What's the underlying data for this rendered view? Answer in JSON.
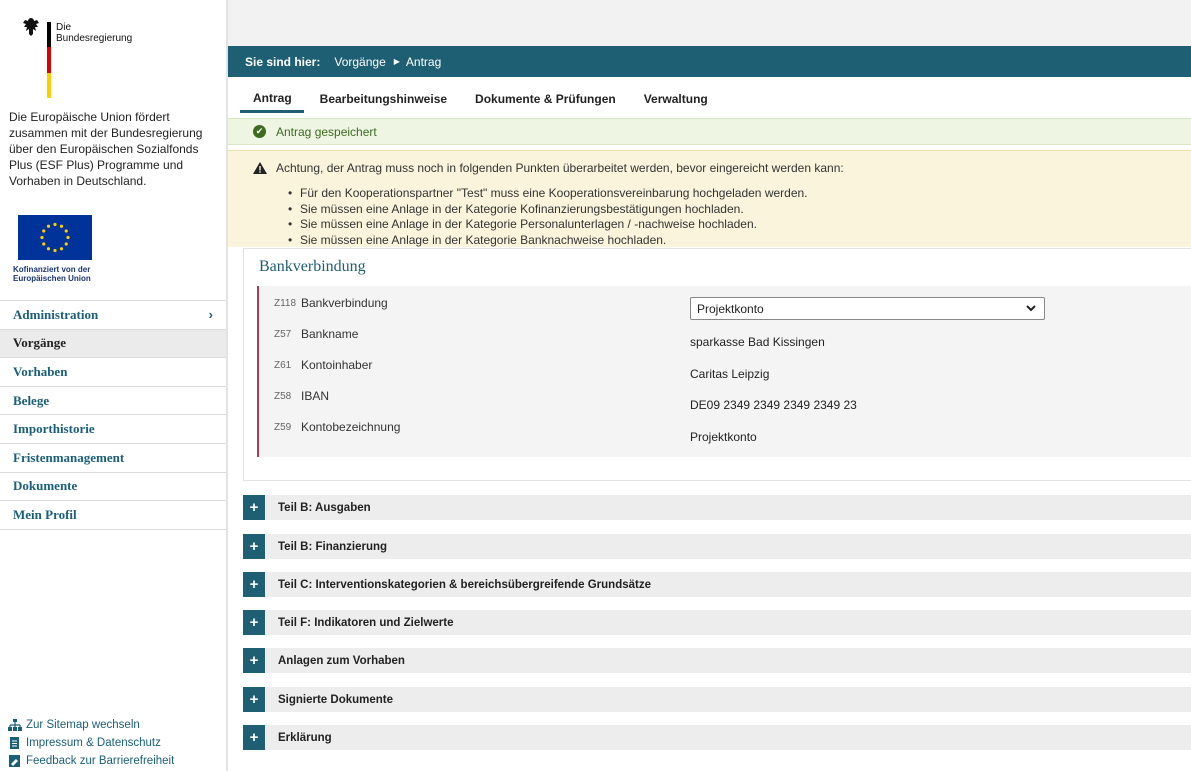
{
  "brand": {
    "line1": "Die",
    "line2": "Bundesregierung"
  },
  "intro": "Die Europäische Union fördert zusammen mit der Bundesregierung über den Europäischen Sozialfonds Plus (ESF Plus) Programme und Vorhaben in Deutschland.",
  "eu_caption": {
    "line1": "Kofinanziert von der",
    "line2": "Europäischen Union"
  },
  "nav": [
    {
      "label": "Administration",
      "chevron": "›"
    },
    {
      "label": "Vorgänge"
    },
    {
      "label": "Vorhaben"
    },
    {
      "label": "Belege"
    },
    {
      "label": "Importhistorie"
    },
    {
      "label": "Fristenmanagement"
    },
    {
      "label": "Dokumente"
    },
    {
      "label": "Mein Profil"
    }
  ],
  "footer": [
    {
      "label": "Zur Sitemap wechseln",
      "icon": "sitemap-icon"
    },
    {
      "label": "Impressum & Datenschutz",
      "icon": "document-icon"
    },
    {
      "label": "Feedback zur Barrierefreiheit",
      "icon": "feedback-icon"
    }
  ],
  "breadcrumb": {
    "label": "Sie sind hier:",
    "items": [
      "Vorgänge",
      "Antrag"
    ]
  },
  "tabs": [
    "Antrag",
    "Bearbeitungshinweise",
    "Dokumente & Prüfungen",
    "Verwaltung"
  ],
  "success": "Antrag gespeichert",
  "warning": {
    "head": "Achtung, der Antrag muss noch in folgenden Punkten überarbeitet werden, bevor eingereicht werden kann:",
    "items": [
      "Für den Kooperationspartner \"Test\" muss eine Kooperationsvereinbarung hochgeladen werden.",
      "Sie müssen eine Anlage in der Kategorie Kofinanzierungsbestätigungen hochladen.",
      "Sie müssen eine Anlage in der Kategorie Personalunterlagen / -nachweise hochladen.",
      "Sie müssen eine Anlage in der Kategorie Banknachweise hochladen."
    ]
  },
  "bank": {
    "title": "Bankverbindung",
    "rows": [
      {
        "code": "Z118",
        "label": "Bankverbindung",
        "value": "Projektkonto",
        "type": "select"
      },
      {
        "code": "Z57",
        "label": "Bankname",
        "value": "sparkasse Bad Kissingen"
      },
      {
        "code": "Z61",
        "label": "Kontoinhaber",
        "value": "Caritas Leipzig"
      },
      {
        "code": "Z58",
        "label": "IBAN",
        "value": "DE09 2349 2349 2349 2349 23"
      },
      {
        "code": "Z59",
        "label": "Kontobezeichnung",
        "value": "Projektkonto"
      }
    ]
  },
  "sections": [
    "Teil B: Ausgaben",
    "Teil B: Finanzierung",
    "Teil C: Interventionskategorien & bereichsübergreifende Grundsätze",
    "Teil F: Indikatoren und Zielwerte",
    "Anlagen zum Vorhaben",
    "Signierte Dokumente",
    "Erklärung"
  ],
  "colors": {
    "accent": "#1e5f73",
    "success": "#3d6b1f",
    "warning_bg": "#fbf4dc",
    "eu_blue": "#003399",
    "eu_gold": "#ffcc00"
  }
}
